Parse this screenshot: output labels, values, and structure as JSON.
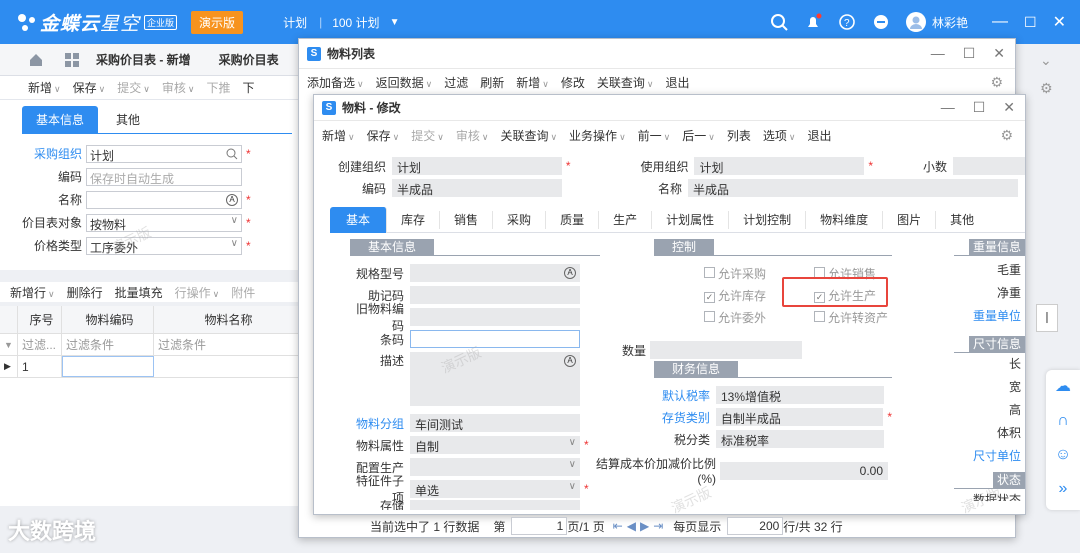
{
  "topbar": {
    "brand": "金蝶云",
    "brand2": "星空",
    "edition": "企业版",
    "demo": "演示版",
    "menu1": "计划",
    "menu2": "100 计划",
    "user": "林彩艳"
  },
  "apptabs": {
    "tab1": "采购价目表 - 新增",
    "tab2": "采购价目表"
  },
  "maintool": [
    "新增",
    "保存",
    "提交",
    "审核",
    "下推",
    "下"
  ],
  "leftform": {
    "tab_basic": "基本信息",
    "tab_other": "其他",
    "fields": [
      {
        "label": "采购组织",
        "value": "计划",
        "req": "*"
      },
      {
        "label": "编码",
        "value": "",
        "placeholder": "保存时自动生成",
        "req": ""
      },
      {
        "label": "名称",
        "value": "",
        "req": "*"
      },
      {
        "label": "价目表对象",
        "value": "按物料",
        "req": "*"
      },
      {
        "label": "价格类型",
        "value": "工序委外",
        "req": "*"
      }
    ]
  },
  "entrytool": [
    "新增行",
    "删除行",
    "批量填充",
    "行操作",
    "附件"
  ],
  "grid": {
    "cols": [
      "序号",
      "物料编码",
      "物料名称"
    ],
    "filter1": "过滤...",
    "filter2": "过滤条件",
    "filter3": "过滤条件",
    "row1": "1"
  },
  "win1": {
    "title": "物料列表",
    "toolbar": [
      "添加备选",
      "返回数据",
      "过滤",
      "刷新",
      "新增",
      "修改",
      "关联查询",
      "退出"
    ]
  },
  "win2": {
    "title": "物料 - 修改",
    "toolbar": [
      "新增",
      "保存",
      "提交",
      "审核",
      "关联查询",
      "业务操作",
      "前一",
      "后一",
      "列表",
      "选项",
      "退出"
    ],
    "head": {
      "create_org_l": "创建组织",
      "create_org": "计划",
      "use_org_l": "使用组织",
      "use_org": "计划",
      "decimal_l": "小数",
      "code_l": "编码",
      "code": "半成品",
      "name_l": "名称",
      "name": "半成品"
    },
    "tabs": [
      "基本",
      "库存",
      "销售",
      "采购",
      "质量",
      "生产",
      "计划属性",
      "计划控制",
      "物料维度",
      "图片",
      "其他"
    ],
    "basic": {
      "sec": "基本信息",
      "spec": "规格型号",
      "mnemonic": "助记码",
      "oldcode": "旧物料编码",
      "barcode": "条码",
      "desc": "描述",
      "group_l": "物料分组",
      "group": "车间测试",
      "prop_l": "物料属性",
      "prop": "自制",
      "config_l": "配置生产",
      "feature_l": "特征件子项",
      "feature": "单选",
      "next_l": "存储"
    },
    "control": {
      "sec": "控制",
      "c1": "允许采购",
      "c2": "允许销售",
      "c3": "允许库存",
      "c4": "允许生产",
      "c5": "允许委外",
      "c6": "允许转资产",
      "qty_l": "数量"
    },
    "finance": {
      "sec": "财务信息",
      "tax_l": "默认税率",
      "tax": "13%增值税",
      "stock_l": "存货类别",
      "stock": "自制半成品",
      "taxcls_l": "税分类",
      "taxcls": "标准税率",
      "ratio_l": "结算成本价加减价比例(%)",
      "ratio": "0.00"
    },
    "right": {
      "weight_sec": "重量信息",
      "gross": "毛重",
      "net": "净重",
      "wunit": "重量单位",
      "size_sec": "尺寸信息",
      "len": "长",
      "wid": "宽",
      "hei": "高",
      "vol": "体积",
      "sunit": "尺寸单位",
      "status_sec": "状态",
      "data_status": "数据状态"
    }
  },
  "pager": {
    "text1": "当前选中了 1 行数据",
    "text2": "第",
    "page": "1",
    "text3": "页/1 页",
    "text4": "每页显示",
    "size": "200",
    "text5": "行/共 32 行"
  },
  "watermark_text": "演示版",
  "footer_mark": "大数跨境",
  "colors": {
    "brand": "#2e8cf0",
    "demo": "#f7931e",
    "highlight": "#e8453c"
  }
}
